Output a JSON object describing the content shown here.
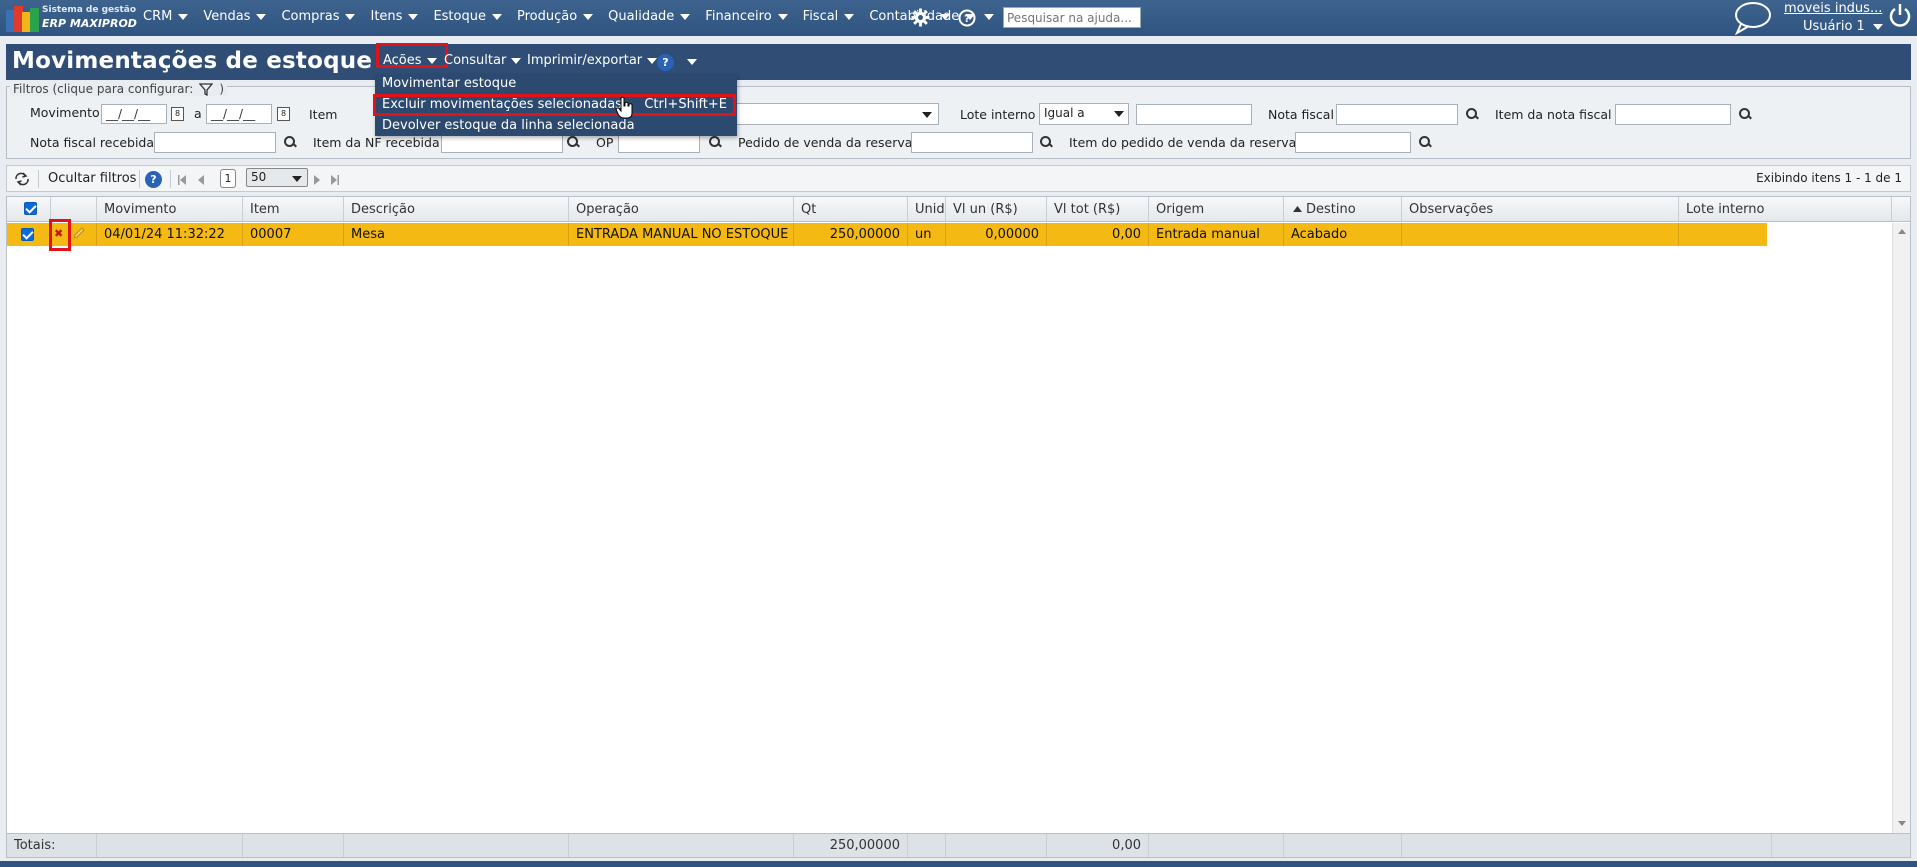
{
  "brand": {
    "line1": "Sistema de gestão",
    "line2": "ERP MAXIPROD",
    "colors": [
      "#3b6fb6",
      "#e03a2c",
      "#f2b51b",
      "#2ba24c"
    ]
  },
  "nav": {
    "items": [
      "CRM",
      "Vendas",
      "Compras",
      "Itens",
      "Estoque",
      "Produção",
      "Qualidade",
      "Financeiro",
      "Fiscal",
      "Contabilidade"
    ],
    "search_placeholder": "Pesquisar na ajuda...",
    "company": "moveis indus...",
    "user": "Usuário 1",
    "icons": [
      "gear-icon",
      "help-icon",
      "chat-icon",
      "power-icon"
    ]
  },
  "page": {
    "title": "Movimentações de estoque",
    "menus": {
      "acoes": "Ações",
      "consultar": "Consultar",
      "imprimir": "Imprimir/exportar",
      "help": "?"
    }
  },
  "dropdown": {
    "items": [
      {
        "label": "Movimentar estoque",
        "shortcut": ""
      },
      {
        "label": "Excluir movimentações selecionadas",
        "shortcut": "Ctrl+Shift+E"
      },
      {
        "label": "Devolver estoque da linha selecionada",
        "shortcut": ""
      }
    ]
  },
  "filters": {
    "legend": "Filtros (clique para configurar:",
    "legend_close": ")",
    "movimento": "Movimento",
    "date_mask": "__/__/__",
    "a": "a",
    "item": "Item",
    "lote_interno": "Lote interno",
    "lote_op": "Igual a",
    "nota_fiscal": "Nota fiscal",
    "item_nota_fiscal": "Item da nota fiscal",
    "nota_fiscal_recebida": "Nota fiscal recebida",
    "item_nf_recebida": "Item da NF recebida",
    "op": "OP",
    "pedido_venda_reserva": "Pedido de venda da reserva",
    "item_pedido_venda_reserva": "Item do pedido de venda da reserva"
  },
  "toolbar": {
    "hide_filters": "Ocultar filtros",
    "page": "1",
    "page_size": "50",
    "showing": "Exibindo itens 1 - 1 de 1"
  },
  "grid": {
    "columns": [
      "Movimento",
      "Item",
      "Descrição",
      "Operação",
      "Qt",
      "Unid",
      "Vl un (R$)",
      "Vl tot (R$)",
      "Origem",
      "Destino",
      "Observações",
      "Lote interno"
    ],
    "sorted_column": "Destino",
    "rows": [
      {
        "movimento": "04/01/24 11:32:22",
        "item": "00007",
        "descricao": "Mesa",
        "operacao": "ENTRADA MANUAL NO ESTOQUE",
        "qt": "250,00000",
        "unid": "un",
        "vl_un": "0,00000",
        "vl_tot": "0,00",
        "origem": "Entrada manual",
        "destino": "Acabado",
        "observacoes": "",
        "lote": ""
      }
    ],
    "totals_label": "Totais:",
    "total_qt": "250,00000",
    "total_vl_tot": "0,00",
    "row_selected_color": "#f5b914"
  }
}
